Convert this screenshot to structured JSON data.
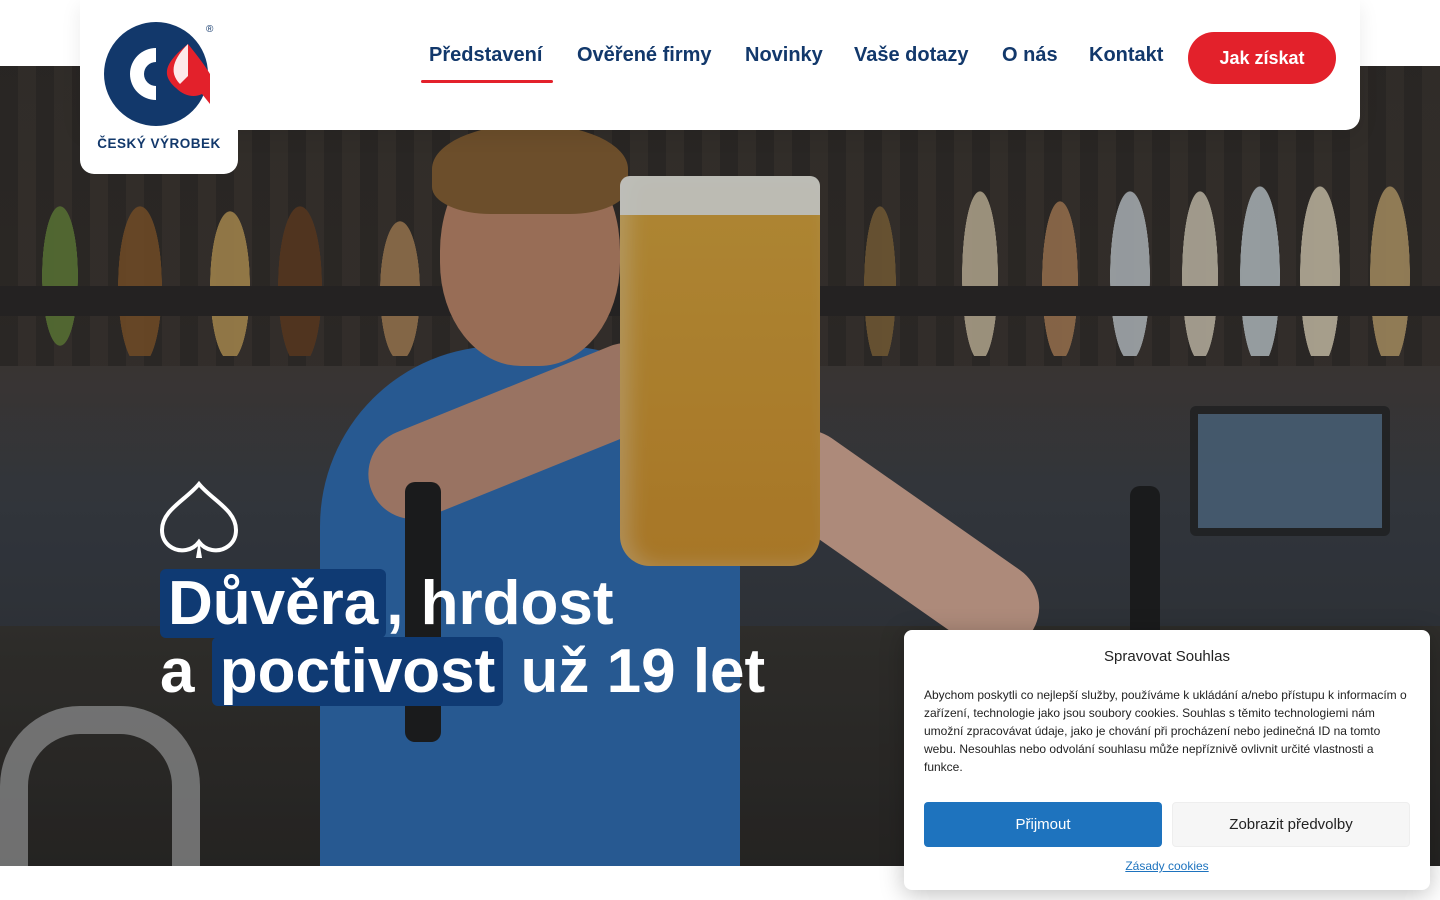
{
  "brand": {
    "name": "ČESKÝ VÝROBEK",
    "registered_mark": "®",
    "colors": {
      "blue": "#12386b",
      "red": "#e3212b",
      "accent_blue": "#1e73be"
    }
  },
  "nav": {
    "items": [
      {
        "label": "Představení",
        "active": true
      },
      {
        "label": "Ověřené firmy",
        "active": false
      },
      {
        "label": "Novinky",
        "active": false
      },
      {
        "label": "Vaše dotazy",
        "active": false
      },
      {
        "label": "O nás",
        "active": false
      },
      {
        "label": "Kontakt",
        "active": false
      }
    ],
    "cta_label": "Jak získat"
  },
  "hero": {
    "icon": "spade-icon",
    "line1_mark": "Důvěra",
    "line1_rest": ", hrdost",
    "line2_a": "a",
    "line2_mark": "poctivost",
    "line2_rest": "už 19 let"
  },
  "cookie": {
    "title": "Spravovat Souhlas",
    "body": "Abychom poskytli co nejlepší služby, používáme k ukládání a/nebo přístupu k informacím o zařízení, technologie jako jsou soubory cookies. Souhlas s těmito technologiemi nám umožní zpracovávat údaje, jako je chování při procházení nebo jedinečná ID na tomto webu. Nesouhlas nebo odvolání souhlasu může nepříznivě ovlivnit určité vlastnosti a funkce.",
    "accept_label": "Přijmout",
    "prefs_label": "Zobrazit předvolby",
    "policy_link": "Zásady cookies"
  }
}
